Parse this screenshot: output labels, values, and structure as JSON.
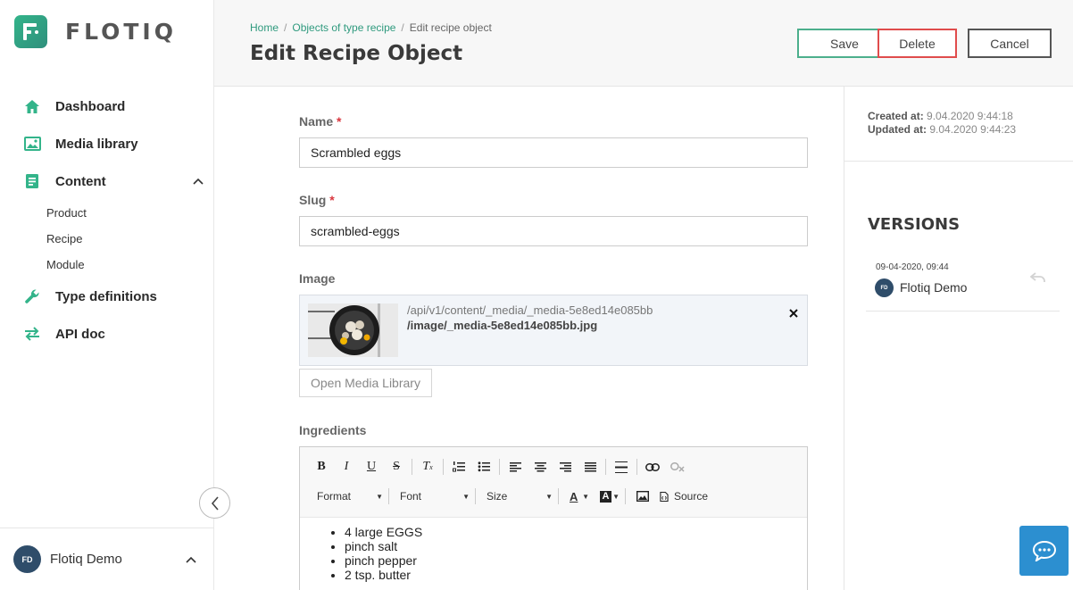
{
  "app": {
    "logo_text": "FLOTIQ",
    "accent": "#33b48a"
  },
  "sidebar": {
    "items": [
      {
        "label": "Dashboard",
        "icon": "home-icon"
      },
      {
        "label": "Media library",
        "icon": "image-icon"
      },
      {
        "label": "Content",
        "icon": "document-icon"
      },
      {
        "label": "Type definitions",
        "icon": "wrench-icon"
      },
      {
        "label": "API doc",
        "icon": "swap-arrows-icon"
      }
    ],
    "content_sub": [
      "Product",
      "Recipe",
      "Module"
    ],
    "user": {
      "initials": "FD",
      "name": "Flotiq Demo"
    }
  },
  "header": {
    "breadcrumb": [
      "Home",
      "Objects of type recipe",
      "Edit recipe object"
    ],
    "title": "Edit Recipe Object",
    "save_label": "Save",
    "delete_label": "Delete",
    "cancel_label": "Cancel"
  },
  "form": {
    "name": {
      "label": "Name",
      "value": "Scrambled eggs"
    },
    "slug": {
      "label": "Slug",
      "value": "scrambled-eggs"
    },
    "image": {
      "label": "Image",
      "path": "/api/v1/content/_media/_media-5e8ed14e085bb",
      "file": "/image/_media-5e8ed14e085bb.jpg",
      "open_library_label": "Open Media Library"
    },
    "ingredients": {
      "label": "Ingredients",
      "format_label": "Format",
      "font_label": "Font",
      "size_label": "Size",
      "source_label": "Source",
      "items": [
        "4 large EGGS",
        "pinch salt",
        "pinch pepper",
        "2 tsp. butter"
      ]
    }
  },
  "meta": {
    "created_label": "Created at:",
    "created_value": "9.04.2020 9:44:18",
    "updated_label": "Updated at:",
    "updated_value": "9.04.2020 9:44:23"
  },
  "versions": {
    "title": "VERSIONS",
    "items": [
      {
        "date": "09-04-2020, 09:44",
        "initials": "FD",
        "user": "Flotiq Demo"
      }
    ]
  }
}
